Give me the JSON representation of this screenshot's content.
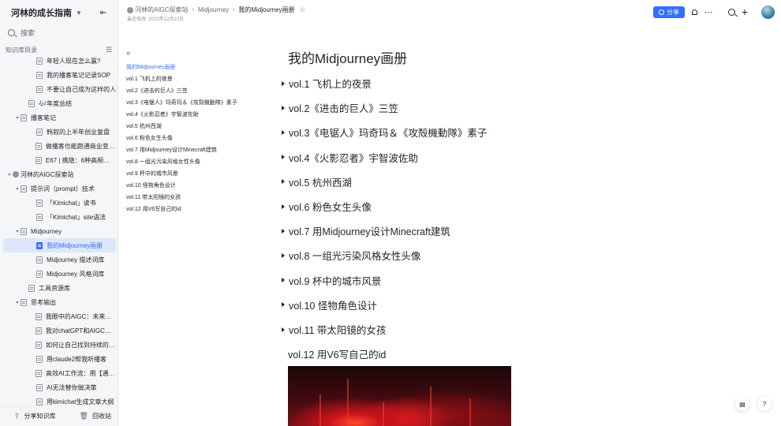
{
  "sidebar": {
    "title": "河林的成长指南",
    "search_placeholder": "搜索",
    "section_label": "知识库目录",
    "items": [
      {
        "label": "年轻人现在怎么赢?",
        "indent": 3,
        "type": "doc",
        "toggle": ""
      },
      {
        "label": "我的播客笔记记录SOP",
        "indent": 3,
        "type": "doc",
        "toggle": ""
      },
      {
        "label": "不要让自己成为这样的人",
        "indent": 3,
        "type": "doc",
        "toggle": ""
      },
      {
        "label": "🎶年度总结",
        "indent": 2,
        "type": "doc",
        "toggle": ""
      },
      {
        "label": "播客笔记",
        "indent": 1,
        "type": "doc",
        "toggle": "▾"
      },
      {
        "label": "韩叙的上半年创业复盘",
        "indent": 3,
        "type": "doc",
        "toggle": ""
      },
      {
        "label": "做播客也能跑通商业变现? | ...",
        "indent": 3,
        "type": "doc",
        "toggle": ""
      },
      {
        "label": "E67 | 携隐：6种高频职业困...",
        "indent": 3,
        "type": "doc",
        "toggle": ""
      },
      {
        "label": "河林的AIGC探索站",
        "indent": 0,
        "type": "globe",
        "toggle": "▾"
      },
      {
        "label": "提示词（prompt）技术",
        "indent": 1,
        "type": "doc",
        "toggle": "▾"
      },
      {
        "label": "「Kimichat」读书",
        "indent": 3,
        "type": "doc",
        "toggle": ""
      },
      {
        "label": "「Kimichat」site语法",
        "indent": 3,
        "type": "doc",
        "toggle": ""
      },
      {
        "label": "Midjourney",
        "indent": 1,
        "type": "doc",
        "toggle": "▾"
      },
      {
        "label": "我的Midjourney画册",
        "indent": 3,
        "type": "doc",
        "toggle": "",
        "active": true
      },
      {
        "label": "Midjourney 描述词库",
        "indent": 3,
        "type": "doc",
        "toggle": ""
      },
      {
        "label": "Midjourney 风格词库",
        "indent": 3,
        "type": "doc",
        "toggle": ""
      },
      {
        "label": "工具资源库",
        "indent": 2,
        "type": "doc",
        "toggle": ""
      },
      {
        "label": "思考输出",
        "indent": 1,
        "type": "doc",
        "toggle": "▾"
      },
      {
        "label": "我眼中的AIGC：未来已来，...",
        "indent": 3,
        "type": "doc",
        "toggle": ""
      },
      {
        "label": "我对chatGPT和AIGC的阶段...",
        "indent": 3,
        "type": "doc",
        "toggle": ""
      },
      {
        "label": "如何让自己找到持续的灵感...",
        "indent": 3,
        "type": "doc",
        "toggle": ""
      },
      {
        "label": "用claude2帮我听播客",
        "indent": 3,
        "type": "doc",
        "toggle": ""
      },
      {
        "label": "高效AI工作流：用【通义听...",
        "indent": 3,
        "type": "doc",
        "toggle": ""
      },
      {
        "label": "AI无法替你做决策",
        "indent": 3,
        "type": "doc",
        "toggle": ""
      },
      {
        "label": "用kimichat生成文章大纲",
        "indent": 3,
        "type": "doc",
        "toggle": ""
      }
    ],
    "footer": {
      "share": "分享知识库",
      "trash": "回收站"
    }
  },
  "topbar": {
    "breadcrumbs": [
      "河林的AIGC探索站",
      "Midjourney",
      "我的Midjourney画册"
    ],
    "modified": "最近修改: 2023年12月23日",
    "share_label": "分享"
  },
  "toc": {
    "items": [
      "我的Midjourney画册",
      "vol.1 飞机上的夜景",
      "vol.2《进击的巨人》三笠",
      "vol.3《电锯人》玛奇玛＆《攻殻機動隊》素子",
      "vol.4《火影忍者》宇智波佐助",
      "vol.5 杭州西湖",
      "vol.6 粉色女生头像",
      "vol.7 用Midjourney设计Minecraft建筑",
      "vol.8 一组光污染风格女性头像",
      "vol.9 杯中的城市风景",
      "vol.10 怪物角色设计",
      "vol.11 带太阳镜的女孩",
      "vol.12 用V6写自己的id"
    ]
  },
  "doc": {
    "title": "我的Midjourney画册",
    "sections": [
      "vol.1 飞机上的夜景",
      "vol.2《进击的巨人》三笠",
      "vol.3《电锯人》玛奇玛＆《攻殻機動隊》素子",
      "vol.4《火影忍者》宇智波佐助",
      "vol.5 杭州西湖",
      "vol.6 粉色女生头像",
      "vol.7 用Midjourney设计Minecraft建筑",
      "vol.8 一组光污染风格女性头像",
      "vol.9 杯中的城市风景",
      "vol.10 怪物角色设计",
      "vol.11 带太阳镜的女孩",
      "vol.12 用V6写自己的id"
    ]
  },
  "colors": {
    "accent": "#3370ff",
    "sidebar_bg": "#f5f6f7",
    "active_bg": "#dde6fb"
  }
}
